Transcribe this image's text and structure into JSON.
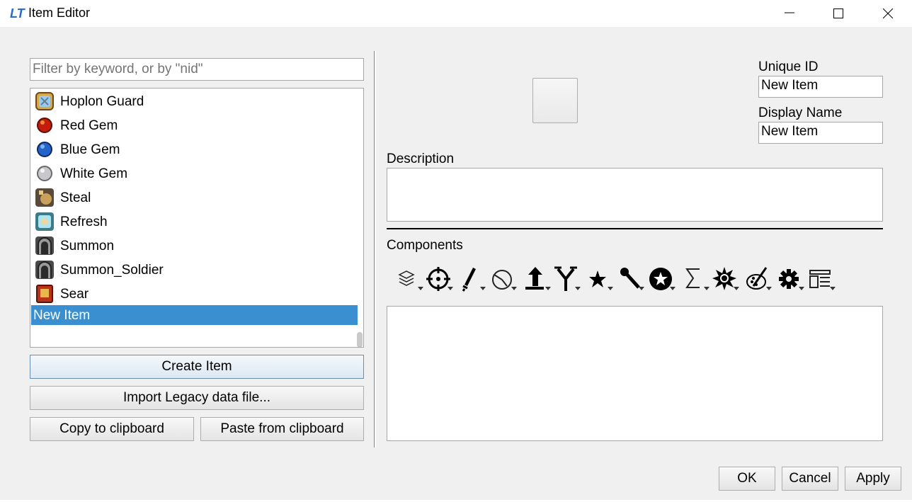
{
  "window": {
    "title": "Item Editor",
    "logo_text": "LT",
    "accent_color": "#3a8fd0"
  },
  "left_panel": {
    "filter": {
      "placeholder": "Filter by keyword, or by \"nid\"",
      "value": ""
    },
    "items": [
      {
        "label": "Hoplon Guard",
        "icon": "shield-icon"
      },
      {
        "label": "Red Gem",
        "icon": "red-gem-icon"
      },
      {
        "label": "Blue Gem",
        "icon": "blue-gem-icon"
      },
      {
        "label": "White Gem",
        "icon": "white-gem-icon"
      },
      {
        "label": "Steal",
        "icon": "steal-icon"
      },
      {
        "label": "Refresh",
        "icon": "refresh-icon"
      },
      {
        "label": "Summon",
        "icon": "summon-icon"
      },
      {
        "label": "Summon_Soldier",
        "icon": "summon-soldier-icon"
      },
      {
        "label": "Sear",
        "icon": "tome-icon"
      },
      {
        "label": "New Item",
        "icon": "",
        "selected": true
      }
    ],
    "buttons": {
      "create": "Create Item",
      "import": "Import Legacy data file...",
      "copy": "Copy to clipboard",
      "paste": "Paste from clipboard"
    }
  },
  "right_panel": {
    "unique_id_label": "Unique ID",
    "unique_id_value": "New Item",
    "display_name_label": "Display Name",
    "display_name_value": "New Item",
    "description_label": "Description",
    "description_value": "",
    "components_label": "Components",
    "component_toolbar": [
      "layers-icon",
      "crosshair-icon",
      "sword-icon",
      "pie-clock-icon",
      "arrow-up-icon",
      "branch-icon",
      "star-icon",
      "wrench-icon",
      "badge-star-icon",
      "sigma-icon",
      "burst-icon",
      "palette-icon",
      "gear-icon",
      "layout-icon"
    ]
  },
  "dialog_buttons": {
    "ok": "OK",
    "cancel": "Cancel",
    "apply": "Apply"
  }
}
